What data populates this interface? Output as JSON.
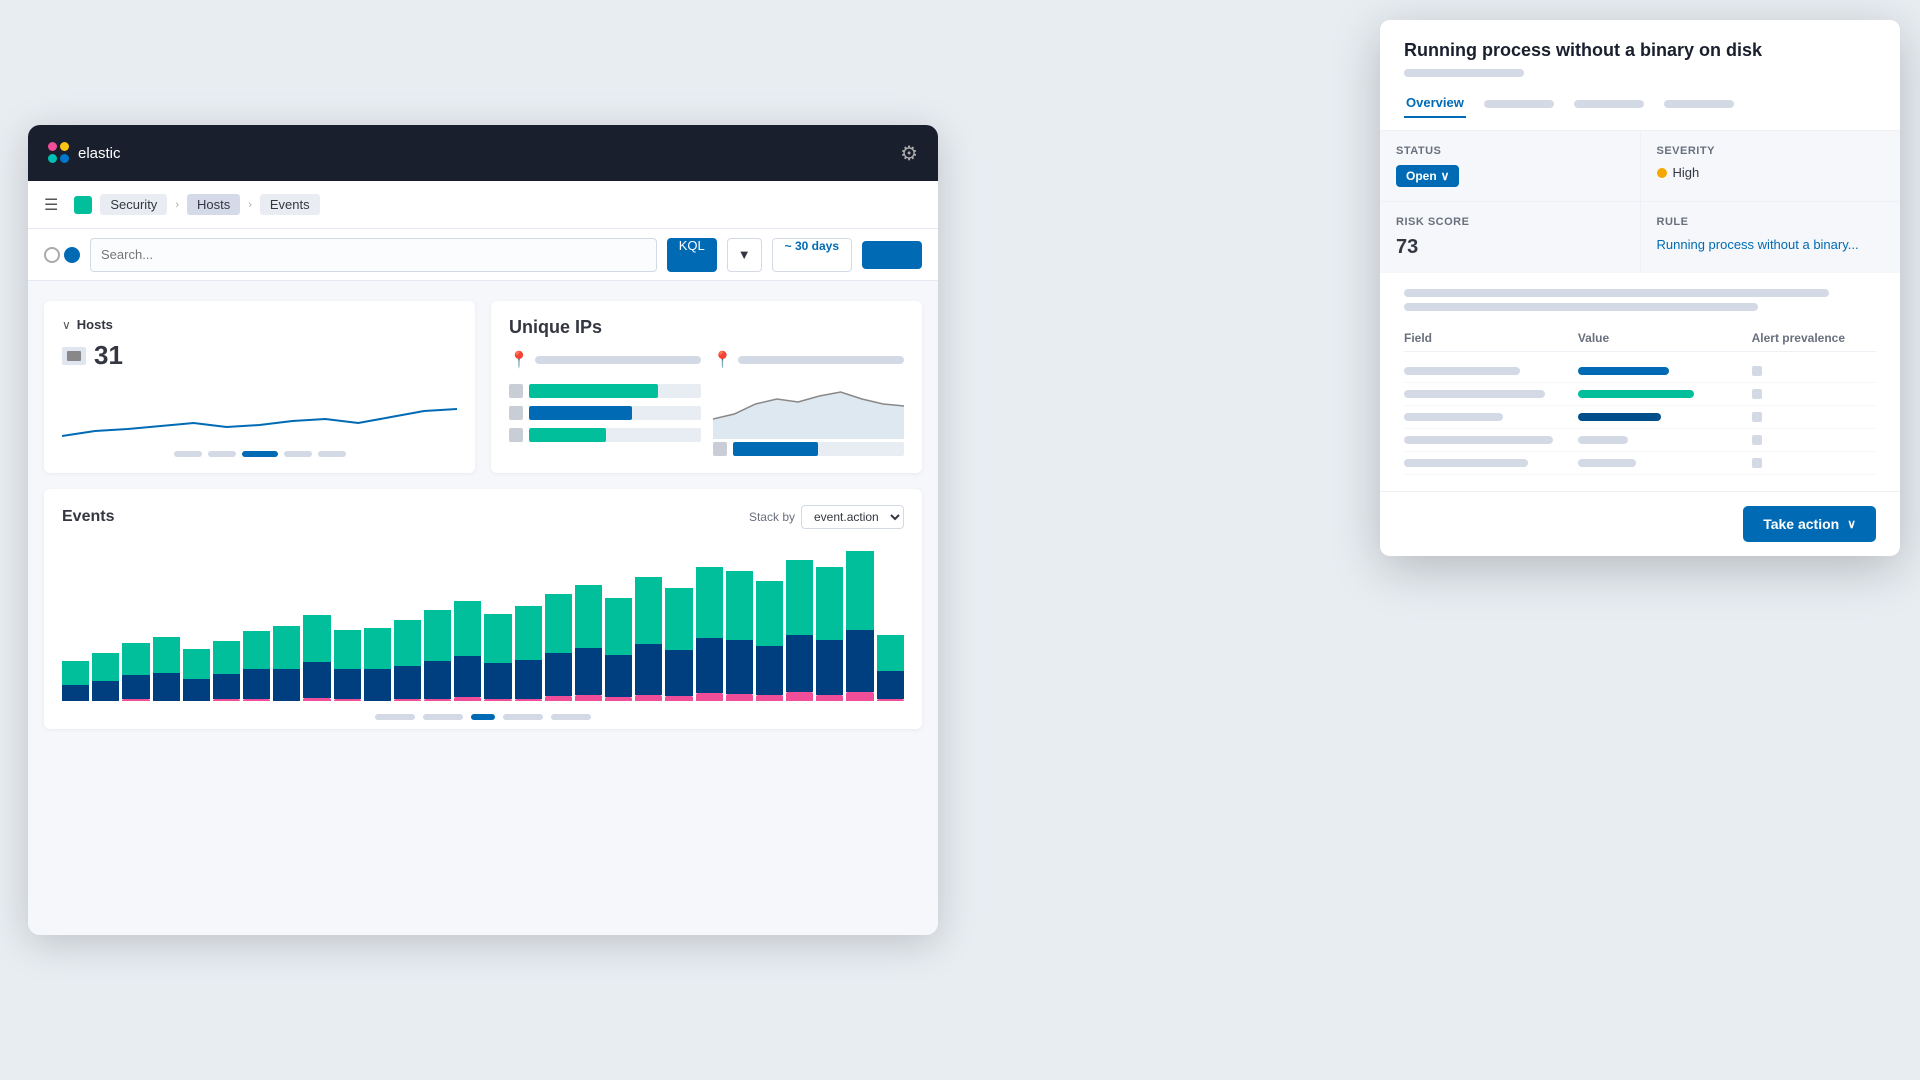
{
  "app": {
    "name": "elastic",
    "logo_text": "elastic"
  },
  "breadcrumb": {
    "items": [
      "Security",
      "Hosts",
      "Events"
    ]
  },
  "filter": {
    "search_placeholder": "Search...",
    "calendar_label": "~ 30 days",
    "submit_label": "KQL",
    "dropdown_label": "▼"
  },
  "hosts_card": {
    "title": "Hosts",
    "count": "31"
  },
  "unique_ips_card": {
    "title": "Unique IPs"
  },
  "events_card": {
    "title": "Events",
    "stack_by_label": "Stack by",
    "stack_by_value": "event.action"
  },
  "overlay": {
    "title": "Running process without a binary on disk",
    "tabs": [
      "Overview",
      "",
      "",
      ""
    ],
    "status_label": "Status",
    "status_value": "Open",
    "severity_label": "Severity",
    "severity_value": "High",
    "risk_score_label": "Risk Score",
    "risk_score_value": "73",
    "rule_label": "Rule",
    "rule_value": "Running process without a binary...",
    "fields": {
      "col_field": "Field",
      "col_value": "Value",
      "col_prevalence": "Alert prevalence",
      "rows": [
        {
          "field_width": "70%",
          "value_width": "55%",
          "value_color": "blue",
          "prevalence_width": "20%"
        },
        {
          "field_width": "85%",
          "value_width": "70%",
          "value_color": "green",
          "prevalence_width": "20%"
        },
        {
          "field_width": "60%",
          "value_width": "50%",
          "value_color": "dark-blue",
          "prevalence_width": "20%"
        },
        {
          "field_width": "90%",
          "value_width": "30%",
          "value_color": "blue",
          "prevalence_width": "20%"
        },
        {
          "field_width": "75%",
          "value_width": "35%",
          "value_color": "blue",
          "prevalence_width": "20%"
        }
      ]
    },
    "take_action_label": "Take action"
  },
  "bar_chart": {
    "bars": [
      {
        "teal": 30,
        "blue": 20,
        "pink": 0
      },
      {
        "teal": 35,
        "blue": 25,
        "pink": 0
      },
      {
        "teal": 40,
        "blue": 30,
        "pink": 2
      },
      {
        "teal": 45,
        "blue": 35,
        "pink": 0
      },
      {
        "teal": 38,
        "blue": 28,
        "pink": 0
      },
      {
        "teal": 42,
        "blue": 32,
        "pink": 3
      },
      {
        "teal": 48,
        "blue": 38,
        "pink": 2
      },
      {
        "teal": 55,
        "blue": 40,
        "pink": 0
      },
      {
        "teal": 60,
        "blue": 45,
        "pink": 4
      },
      {
        "teal": 50,
        "blue": 38,
        "pink": 2
      },
      {
        "teal": 52,
        "blue": 40,
        "pink": 0
      },
      {
        "teal": 58,
        "blue": 42,
        "pink": 3
      },
      {
        "teal": 65,
        "blue": 48,
        "pink": 2
      },
      {
        "teal": 70,
        "blue": 52,
        "pink": 5
      },
      {
        "teal": 62,
        "blue": 46,
        "pink": 3
      },
      {
        "teal": 68,
        "blue": 50,
        "pink": 2
      },
      {
        "teal": 75,
        "blue": 55,
        "pink": 6
      },
      {
        "teal": 80,
        "blue": 60,
        "pink": 8
      },
      {
        "teal": 72,
        "blue": 53,
        "pink": 5
      },
      {
        "teal": 85,
        "blue": 65,
        "pink": 7
      },
      {
        "teal": 78,
        "blue": 58,
        "pink": 6
      },
      {
        "teal": 90,
        "blue": 70,
        "pink": 10
      },
      {
        "teal": 88,
        "blue": 68,
        "pink": 9
      },
      {
        "teal": 82,
        "blue": 62,
        "pink": 7
      },
      {
        "teal": 95,
        "blue": 72,
        "pink": 11
      },
      {
        "teal": 92,
        "blue": 70,
        "pink": 8
      },
      {
        "teal": 100,
        "blue": 78,
        "pink": 12
      },
      {
        "teal": 45,
        "blue": 35,
        "pink": 3
      }
    ]
  }
}
